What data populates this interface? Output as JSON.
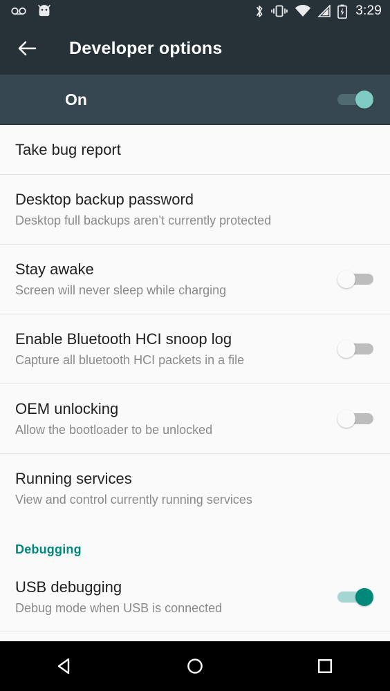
{
  "status_bar": {
    "left_icons": [
      "voicemail-icon",
      "android-bug-icon"
    ],
    "right_icons": [
      "bluetooth-icon",
      "vibrate-icon",
      "wifi-icon",
      "cell-signal-icon",
      "battery-charging-icon"
    ],
    "time": "3:29"
  },
  "toolbar": {
    "back_icon": "arrow-back-icon",
    "title": "Developer options"
  },
  "master_switch": {
    "label": "On",
    "state": "on"
  },
  "colors": {
    "toolbar_bg": "#263238",
    "master_bar_bg": "#37474f",
    "accent_teal": "#00897b",
    "accent_teal_light": "#80cbc4",
    "list_bg": "#fafafa",
    "divider": "#e3e3e3",
    "title_text": "#212121",
    "subtitle_text": "#8a8a8a",
    "nav_bar_bg": "#000000"
  },
  "list": [
    {
      "kind": "item",
      "title": "Take bug report",
      "subtitle": "",
      "switch": null
    },
    {
      "kind": "item",
      "title": "Desktop backup password",
      "subtitle": "Desktop full backups aren’t currently protected",
      "switch": null
    },
    {
      "kind": "item",
      "title": "Stay awake",
      "subtitle": "Screen will never sleep while charging",
      "switch": "off"
    },
    {
      "kind": "item",
      "title": "Enable Bluetooth HCI snoop log",
      "subtitle": "Capture all bluetooth HCI packets in a file",
      "switch": "off"
    },
    {
      "kind": "item",
      "title": "OEM unlocking",
      "subtitle": "Allow the bootloader to be unlocked",
      "switch": "off"
    },
    {
      "kind": "item",
      "title": "Running services",
      "subtitle": "View and control currently running services",
      "switch": null
    },
    {
      "kind": "header",
      "title": "Debugging"
    },
    {
      "kind": "item",
      "title": "USB debugging",
      "subtitle": "Debug mode when USB is connected",
      "switch": "on"
    }
  ],
  "nav_bar": {
    "back_label": "back-nav-button",
    "home_label": "home-nav-button",
    "recents_label": "recents-nav-button"
  }
}
